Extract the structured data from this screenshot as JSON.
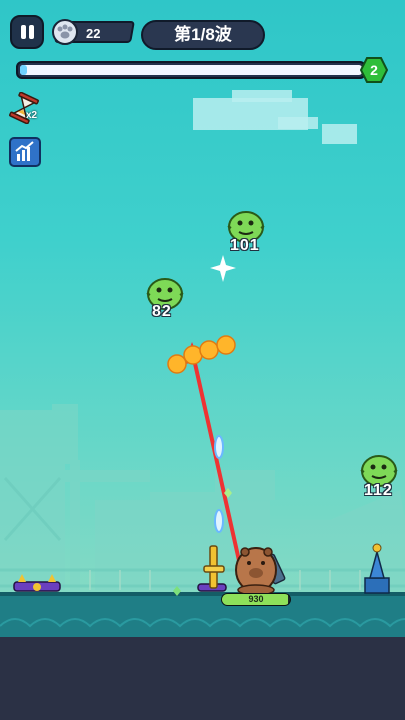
{
  "hud": {
    "paw_count": "22",
    "wave_label": "第1/8波",
    "wave_progress": 0.02,
    "level_badge": "2"
  },
  "skills": {
    "hourglass_multiplier": "x2"
  },
  "monsters": [
    {
      "hp": "101"
    },
    {
      "hp": "82"
    },
    {
      "hp": "112"
    }
  ],
  "player": {
    "hp": "930",
    "hp_fraction": 0.97
  },
  "colors": {
    "sky": "#3fd0cc",
    "ground": "#1f7e86",
    "monster_green": "#7ed957",
    "aim_arrow": "#ee3333",
    "bullet_orange": "#ffb52a"
  }
}
